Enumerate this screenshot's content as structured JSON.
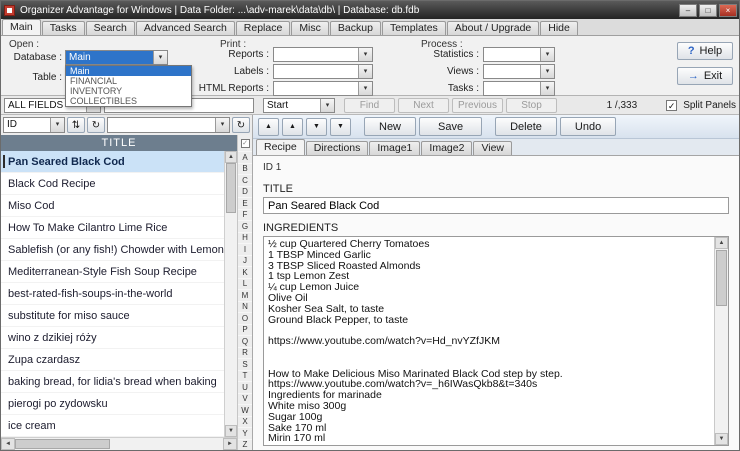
{
  "window": {
    "title": "Organizer Advantage for Windows | Data Folder: ...\\adv-marek\\data\\db\\ | Database: db.fdb"
  },
  "icons": {
    "minimize": "–",
    "maximize": "□",
    "close": "×",
    "dropdown": "▾",
    "refresh": "↻",
    "sort": "⇅",
    "help": "?",
    "exit": "→",
    "up": "▲",
    "down": "▼",
    "left": "◄",
    "right": "►",
    "check": "✓"
  },
  "main_tabs": [
    "Main",
    "Tasks",
    "Search",
    "Advanced Search",
    "Replace",
    "Misc",
    "Backup",
    "Templates",
    "About / Upgrade",
    "Hide"
  ],
  "toolbar": {
    "open_group_label": "Open :",
    "database_label": "Database :",
    "database_value": "Main",
    "database_options": [
      "Main",
      "FINANCIAL",
      "INVENTORY",
      "COLLECTIBLES"
    ],
    "table_label": "Table :",
    "table_value": "",
    "print_group_label": "Print :",
    "reports_label": "Reports :",
    "labels_label": "Labels :",
    "html_reports_label": "HTML Reports :",
    "process_group_label": "Process :",
    "statistics_label": "Statistics :",
    "views_label": "Views :",
    "tasks_label": "Tasks :",
    "help_button": "Help",
    "exit_button": "Exit"
  },
  "search_bar": {
    "field_scope": "ALL FIELDS",
    "query_value": "",
    "match_mode": "Start",
    "find_button": "Find",
    "next_button": "Next",
    "previous_button": "Previous",
    "stop_button": "Stop",
    "record_position": "1 /,333",
    "split_panels_label": "Split Panels"
  },
  "record_list": {
    "sort_field": "ID",
    "lookup_value": "",
    "column_header": "TITLE",
    "items": [
      "Pan Seared Black Cod",
      "Black Cod Recipe",
      "Miso Cod",
      "How To Make Cilantro Lime Rice",
      "Sablefish (or any fish!) Chowder with Lemon",
      "Mediterranean-Style Fish Soup Recipe",
      "best-rated-fish-soups-in-the-world",
      "substitute for miso sauce",
      "wino z dzikiej róży",
      "Zupa czardasz",
      "baking bread, for lidia's bread when baking",
      "pierogi po zydowsku",
      "ice cream"
    ],
    "alphabet": [
      "A",
      "B",
      "C",
      "D",
      "E",
      "F",
      "G",
      "H",
      "I",
      "J",
      "K",
      "L",
      "M",
      "N",
      "O",
      "P",
      "Q",
      "R",
      "S",
      "T",
      "U",
      "V",
      "W",
      "X",
      "Y",
      "Z"
    ]
  },
  "detail": {
    "actions": {
      "new_label": "New",
      "save_label": "Save",
      "delete_label": "Delete",
      "undo_label": "Undo"
    },
    "tabs": [
      "Recipe",
      "Directions",
      "Image1",
      "Image2",
      "View"
    ],
    "id_label": "ID",
    "id_value": "1",
    "title_label": "TITLE",
    "title_value": "Pan Seared Black Cod",
    "ingredients_label": "INGREDIENTS",
    "ingredients_value": "½ cup Quartered Cherry Tomatoes\n1 TBSP Minced Garlic\n3 TBSP Sliced Roasted Almonds\n1 tsp Lemon Zest\n¼ cup Lemon Juice\nOlive Oil\nKosher Sea Salt, to taste\nGround Black Pepper, to taste\n\nhttps://www.youtube.com/watch?v=Hd_nvYZfJKM\n\n\nHow to Make Delicious Miso Marinated Black Cod step by step.\nhttps://www.youtube.com/watch?v=_h6IWasQkb8&t=340s\nIngredients for marinade\nWhite miso 300g\nSugar 100g\nSake 170 ml\nMirin 170 ml"
  }
}
